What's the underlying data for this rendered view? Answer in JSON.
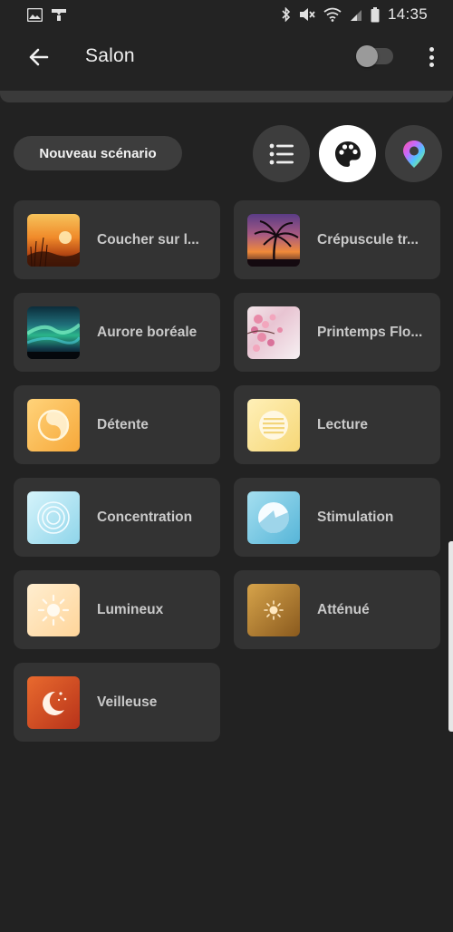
{
  "status_bar": {
    "time": "14:35",
    "left_icons": [
      "image-icon",
      "hue-bridge-icon"
    ],
    "right_icons": [
      "bluetooth-icon",
      "mute-icon",
      "wifi-icon",
      "signal-icon",
      "battery-icon"
    ]
  },
  "header": {
    "title": "Salon",
    "back_icon": "arrow-left-icon",
    "toggle_on": false,
    "more_icon": "more-vertical-icon"
  },
  "toolbar": {
    "new_scene_label": "Nouveau scénario",
    "views": [
      {
        "icon": "list-icon",
        "active": false
      },
      {
        "icon": "palette-icon",
        "active": true
      },
      {
        "icon": "color-picker-icon",
        "active": false
      }
    ]
  },
  "scenes": [
    {
      "label": "Coucher sur l...",
      "thumb": "photo-sunset"
    },
    {
      "label": "Crépuscule tr...",
      "thumb": "photo-tropical-twilight"
    },
    {
      "label": "Aurore boréale",
      "thumb": "photo-aurora"
    },
    {
      "label": "Printemps Flo...",
      "thumb": "photo-spring-blossom"
    },
    {
      "label": "Détente",
      "thumb": "relax-icon"
    },
    {
      "label": "Lecture",
      "thumb": "read-icon"
    },
    {
      "label": "Concentration",
      "thumb": "concentrate-icon"
    },
    {
      "label": "Stimulation",
      "thumb": "energize-icon"
    },
    {
      "label": "Lumineux",
      "thumb": "bright-icon"
    },
    {
      "label": "Atténué",
      "thumb": "dimmed-icon"
    },
    {
      "label": "Veilleuse",
      "thumb": "nightlight-icon"
    }
  ],
  "colors": {
    "background": "#222222",
    "tile": "#333333",
    "button": "#3d3d3d",
    "active_button": "#ffffff"
  }
}
